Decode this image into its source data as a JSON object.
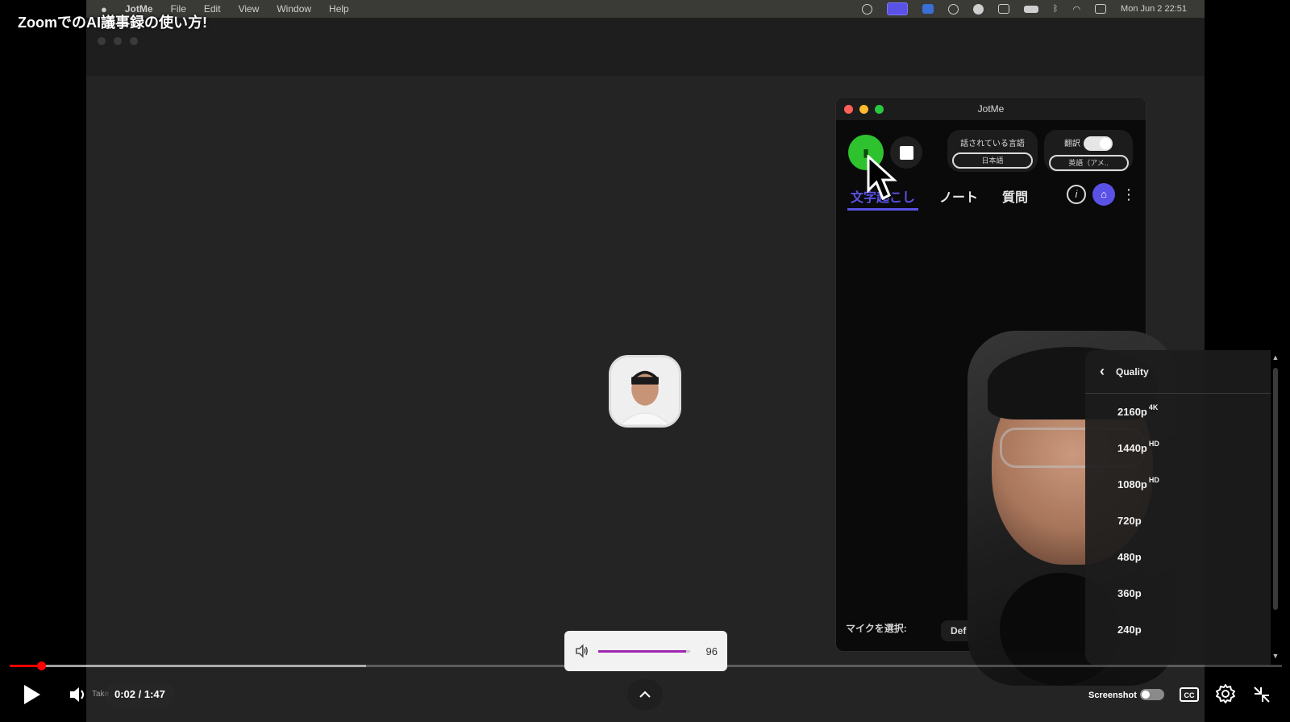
{
  "video": {
    "title": "ZoomでのAI議事録の使い方!",
    "time_display": "0:02 / 1:47",
    "take_label": "Take",
    "progress_fraction": 0.025,
    "buffered_fraction": 0.28
  },
  "mac_menubar": {
    "app_name": "JotMe",
    "menus": [
      "File",
      "Edit",
      "View",
      "Window",
      "Help"
    ],
    "clock": "Mon Jun 2  22:51"
  },
  "jotme": {
    "window_title": "JotMe",
    "record_icon": "microphone-icon",
    "spoken_language_label": "話されている言語",
    "spoken_language_value": "日本語",
    "translation_label": "翻訳",
    "translation_value": "英語（アメ..",
    "tabs": [
      "文字起こし",
      "ノート",
      "質問"
    ],
    "mic_select_label": "マイクを選択:",
    "mic_select_value": "Def"
  },
  "quality_menu": {
    "title": "Quality",
    "options": [
      {
        "label": "2160p",
        "badge": "4K"
      },
      {
        "label": "1440p",
        "badge": "HD"
      },
      {
        "label": "1080p",
        "badge": "HD"
      },
      {
        "label": "720p",
        "badge": ""
      },
      {
        "label": "480p",
        "badge": ""
      },
      {
        "label": "360p",
        "badge": ""
      },
      {
        "label": "240p",
        "badge": ""
      }
    ]
  },
  "volume": {
    "value": "96",
    "fraction": 0.96
  },
  "screenshot_toggle_label": "Screenshot",
  "colors": {
    "accent_purple": "#5a52e6",
    "progress_red": "#ff0000",
    "record_green": "#2ec22e",
    "volume_fill": "#9c27b0"
  }
}
